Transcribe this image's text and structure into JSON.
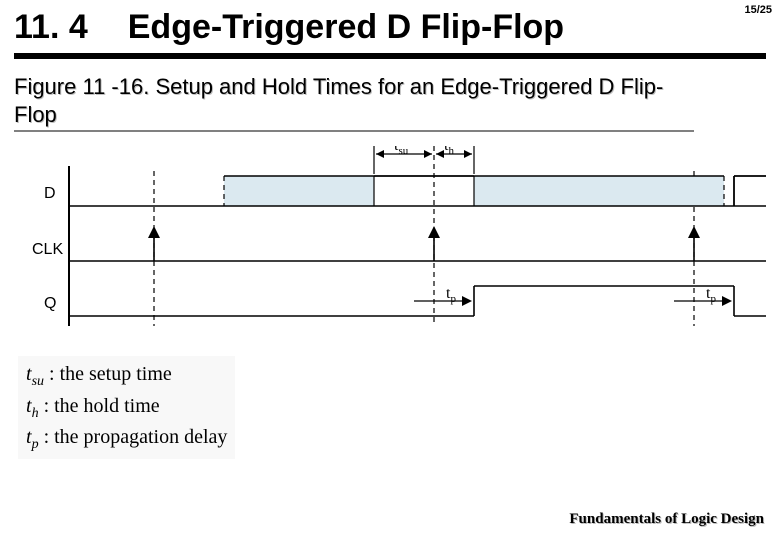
{
  "header": {
    "section_num": "11. 4",
    "section_title": "Edge-Triggered D Flip-Flop",
    "page_num": "15/25"
  },
  "caption": "Figure 11 -16. Setup and Hold Times for an Edge-Triggered D Flip-Flop",
  "signals": {
    "d": "D",
    "clk": "CLK",
    "q": "Q"
  },
  "timing_labels": {
    "tsu": "t",
    "tsu_sub": "su",
    "th": "t",
    "th_sub": "h",
    "tp": "t",
    "tp_sub": "p"
  },
  "legend": {
    "tsu": {
      "sym": "t",
      "sub": "su",
      "text": " : the setup time"
    },
    "th": {
      "sym": "t",
      "sub": "h",
      "text": " : the hold time"
    },
    "tp": {
      "sym": "t",
      "sub": "p",
      "text": " : the propagation delay"
    }
  },
  "footer": "Fundamentals of Logic Design",
  "chart_data": {
    "type": "timing-diagram",
    "x_range": [
      0,
      720
    ],
    "clk_edges": [
      140,
      420,
      680
    ],
    "d_high_intervals": [
      [
        210,
        460
      ],
      [
        710,
        720
      ]
    ],
    "d_shaded_intervals": [
      [
        210,
        360
      ],
      [
        460,
        710
      ]
    ],
    "q_high_intervals": [
      [
        460,
        720
      ]
    ],
    "tsu_span": [
      360,
      420
    ],
    "th_span": [
      420,
      460
    ],
    "tp_markers": [
      [
        420,
        460
      ],
      [
        680,
        720
      ]
    ]
  }
}
